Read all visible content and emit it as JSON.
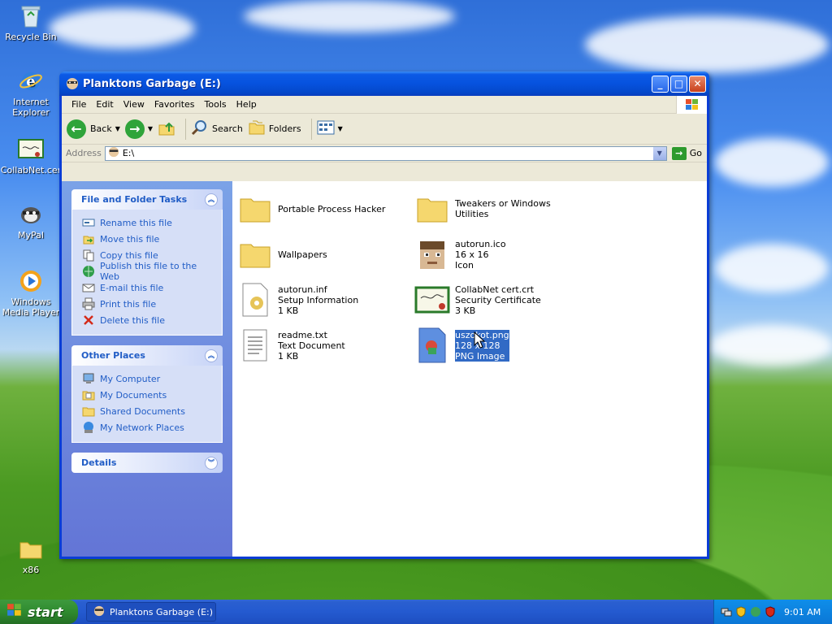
{
  "desktop": {
    "icons": [
      {
        "label": "Recycle Bin",
        "icon": "recycle-bin-icon"
      },
      {
        "label": "Internet Explorer",
        "icon": "internet-explorer-icon"
      },
      {
        "label": "CollabNet.cer",
        "icon": "certificate-icon"
      },
      {
        "label": "MyPal",
        "icon": "mypal-icon"
      },
      {
        "label": "Windows Media Player",
        "icon": "media-player-icon"
      },
      {
        "label": "x86",
        "icon": "folder-icon"
      }
    ]
  },
  "window": {
    "title": "Planktons Garbage (E:)",
    "menu": [
      "File",
      "Edit",
      "View",
      "Favorites",
      "Tools",
      "Help"
    ],
    "toolbar": {
      "back_label": "Back",
      "search_label": "Search",
      "folders_label": "Folders"
    },
    "address": {
      "label": "Address",
      "value": "E:\\",
      "go_label": "Go"
    },
    "panels": {
      "file_tasks": {
        "title": "File and Folder Tasks",
        "items": [
          "Rename this file",
          "Move this file",
          "Copy this file",
          "Publish this file to the Web",
          "E-mail this file",
          "Print this file",
          "Delete this file"
        ]
      },
      "other_places": {
        "title": "Other Places",
        "items": [
          "My Computer",
          "My Documents",
          "Shared Documents",
          "My Network Places"
        ]
      },
      "details": {
        "title": "Details"
      }
    },
    "files": [
      {
        "name": "Portable Process Hacker",
        "line2": "",
        "line3": ""
      },
      {
        "name": "Tweakers or Windows Utilities",
        "line2": "",
        "line3": ""
      },
      {
        "name": "Wallpapers",
        "line2": "",
        "line3": ""
      },
      {
        "name": "autorun.ico",
        "line2": "16 x 16",
        "line3": "Icon"
      },
      {
        "name": "autorun.inf",
        "line2": "Setup Information",
        "line3": "1 KB"
      },
      {
        "name": "CollabNet cert.crt",
        "line2": "Security Certificate",
        "line3": "3 KB"
      },
      {
        "name": "readme.txt",
        "line2": "Text Document",
        "line3": "1 KB"
      },
      {
        "name": "uszokot.png",
        "line2": "128 x 128",
        "line3": "PNG Image"
      }
    ]
  },
  "taskbar": {
    "start_label": "start",
    "task_label": "Planktons Garbage (E:)",
    "clock": "9:01 AM"
  }
}
